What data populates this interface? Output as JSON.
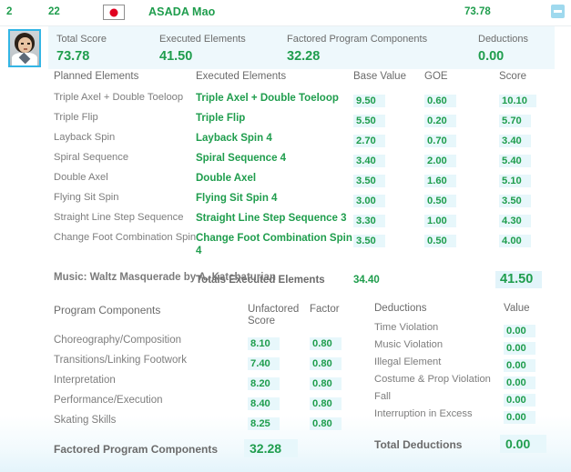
{
  "header": {
    "rank": "2",
    "start_number": "22",
    "flag_country": "Japan",
    "skater_name": "ASADA Mao",
    "total_score": "73.78",
    "toggle_icon": "minus-collapse-icon"
  },
  "summary": {
    "cells": [
      {
        "label": "Total Score",
        "value": "73.78"
      },
      {
        "label": "Executed Elements",
        "value": "41.50"
      },
      {
        "label": "Factored Program Components",
        "value": "32.28"
      },
      {
        "label": "Deductions",
        "value": "0.00"
      }
    ]
  },
  "elements_table": {
    "headers": {
      "planned": "Planned Elements",
      "executed": "Executed Elements",
      "base": "Base Value",
      "goe": "GOE",
      "score": "Score"
    },
    "rows": [
      {
        "planned": "Triple Axel + Double Toeloop",
        "executed": "Triple Axel + Double Toeloop",
        "base": "9.50",
        "goe": "0.60",
        "score": "10.10"
      },
      {
        "planned": "Triple Flip",
        "executed": "Triple Flip",
        "base": "5.50",
        "goe": "0.20",
        "score": "5.70"
      },
      {
        "planned": "Layback Spin",
        "executed": "Layback Spin 4",
        "base": "2.70",
        "goe": "0.70",
        "score": "3.40"
      },
      {
        "planned": "Spiral Sequence",
        "executed": "Spiral Sequence 4",
        "base": "3.40",
        "goe": "2.00",
        "score": "5.40"
      },
      {
        "planned": "Double Axel",
        "executed": "Double Axel",
        "base": "3.50",
        "goe": "1.60",
        "score": "5.10"
      },
      {
        "planned": "Flying Sit Spin",
        "executed": "Flying Sit Spin 4",
        "base": "3.00",
        "goe": "0.50",
        "score": "3.50"
      },
      {
        "planned": "Straight Line Step Sequence",
        "executed": "Straight Line Step Sequence 3",
        "base": "3.30",
        "goe": "1.00",
        "score": "4.30"
      },
      {
        "planned": "Change Foot Combination Spin",
        "executed": "Change Foot Combination Spin 4",
        "base": "3.50",
        "goe": "0.50",
        "score": "4.00"
      }
    ],
    "totals": {
      "label": "Totals Executed Elements",
      "base": "34.40",
      "score": "41.50"
    }
  },
  "music": "Music: Waltz Masquerade by A. Katchaturian",
  "program_components": {
    "headers": {
      "name": "Program Components",
      "unfactored": "Unfactored Score",
      "factor": "Factor"
    },
    "rows": [
      {
        "name": "Choreography/Composition",
        "unfactored": "8.10",
        "factor": "0.80"
      },
      {
        "name": "Transitions/Linking Footwork",
        "unfactored": "7.40",
        "factor": "0.80"
      },
      {
        "name": "Interpretation",
        "unfactored": "8.20",
        "factor": "0.80"
      },
      {
        "name": "Performance/Execution",
        "unfactored": "8.40",
        "factor": "0.80"
      },
      {
        "name": "Skating Skills",
        "unfactored": "8.25",
        "factor": "0.80"
      }
    ],
    "total": {
      "label": "Factored Program Components",
      "value": "32.28"
    }
  },
  "deductions": {
    "headers": {
      "name": "Deductions",
      "value": "Value"
    },
    "rows": [
      {
        "name": "Time Violation",
        "value": "0.00"
      },
      {
        "name": "Music Violation",
        "value": "0.00"
      },
      {
        "name": "Illegal Element",
        "value": "0.00"
      },
      {
        "name": "Costume & Prop Violation",
        "value": "0.00"
      },
      {
        "name": "Fall",
        "value": "0.00"
      },
      {
        "name": "Interruption in Excess",
        "value": "0.00"
      }
    ],
    "total": {
      "label": "Total Deductions",
      "value": "0.00"
    }
  },
  "colors": {
    "accent_green": "#1f9d4d",
    "highlight_cyan": "#e7f7fb",
    "band_blue": "#eef8fc",
    "label_gray": "#6b6b6b",
    "toggle_blue": "#9fd9ee"
  }
}
